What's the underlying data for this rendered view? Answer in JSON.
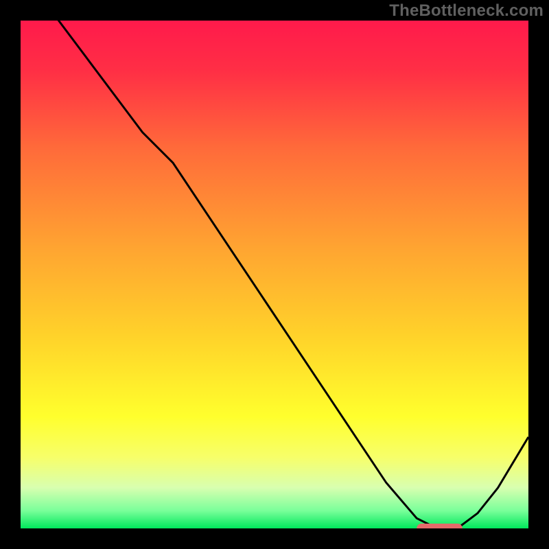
{
  "watermark": "TheBottleneck.com",
  "chart_data": {
    "type": "line",
    "title": "",
    "xlabel": "",
    "ylabel": "",
    "xlim": [
      0,
      100
    ],
    "ylim": [
      0,
      100
    ],
    "x": [
      0,
      6,
      12,
      18,
      24,
      30,
      36,
      42,
      48,
      54,
      60,
      66,
      72,
      78,
      82,
      86,
      90,
      94,
      100
    ],
    "values": [
      110,
      102,
      94,
      86,
      78,
      72,
      63,
      54,
      45,
      36,
      27,
      18,
      9,
      2,
      0,
      0,
      3,
      8,
      18
    ],
    "marker_segment": {
      "x0": 78,
      "x1": 87,
      "y": 0
    },
    "gradient_stops": [
      {
        "offset": 0.0,
        "color": "#ff1a4b"
      },
      {
        "offset": 0.1,
        "color": "#ff2f45"
      },
      {
        "offset": 0.25,
        "color": "#ff6a3a"
      },
      {
        "offset": 0.45,
        "color": "#ffa531"
      },
      {
        "offset": 0.62,
        "color": "#ffd22a"
      },
      {
        "offset": 0.78,
        "color": "#ffff2d"
      },
      {
        "offset": 0.86,
        "color": "#f7ff6a"
      },
      {
        "offset": 0.92,
        "color": "#d8ffb0"
      },
      {
        "offset": 0.965,
        "color": "#7aff9a"
      },
      {
        "offset": 1.0,
        "color": "#00e85c"
      }
    ],
    "curve_color": "#000000",
    "marker_color": "#e46a6a",
    "background_frame": "#000000"
  }
}
